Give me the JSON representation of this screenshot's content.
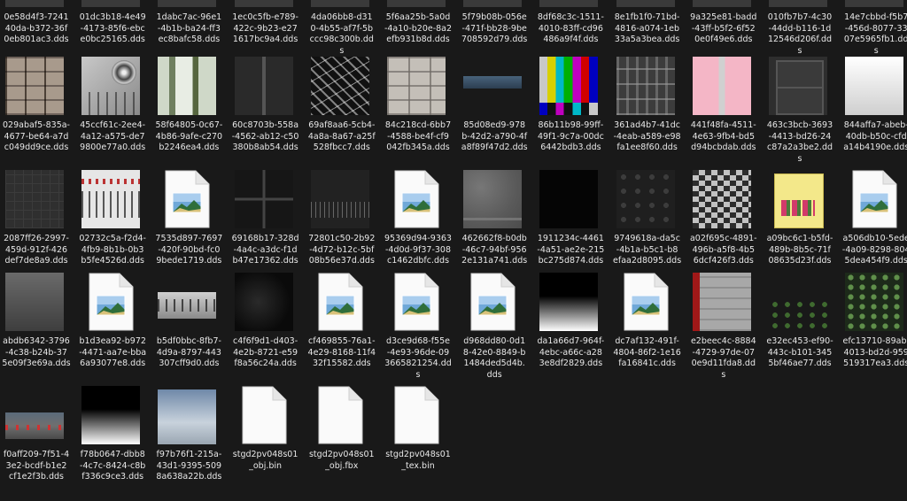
{
  "tiles": [
    {
      "lines": [
        "0e58d4f3-7241",
        "40da-b372-36f",
        "0eb801ac3.dds"
      ],
      "thumb": "dark-strip"
    },
    {
      "lines": [
        "01dc3b18-4e49",
        "-4173-85f6-ebc",
        "e0bc25165.dds"
      ],
      "thumb": "dark-strip"
    },
    {
      "lines": [
        "1dabc7ac-96e1",
        "-4b1b-ba24-ff3",
        "ec8bafc58.dds"
      ],
      "thumb": "dark-strip"
    },
    {
      "lines": [
        "1ec0c5fb-e789-",
        "422c-9b23-e27",
        "1617bc9a4.dds"
      ],
      "thumb": "dark-strip"
    },
    {
      "lines": [
        "4da06bb8-d31",
        "0-4b55-af7f-5b",
        "ccc98c300b.dd",
        "s"
      ],
      "thumb": "dark-strip"
    },
    {
      "lines": [
        "5f6aa25b-5a0d",
        "-4a10-b20e-8a2",
        "efb931b8d.dds"
      ],
      "thumb": "dark-strip"
    },
    {
      "lines": [
        "5f79b08b-056e",
        "-471f-bb28-9be",
        "708592d79.dds"
      ],
      "thumb": "dark-strip"
    },
    {
      "lines": [
        "8df68c3c-1511-",
        "4010-83ff-cd96",
        "486a9f4f.dds"
      ],
      "thumb": "dark-strip"
    },
    {
      "lines": [
        "8e1fb1f0-71bd-",
        "4816-a074-1eb",
        "33a5a3bea.dds"
      ],
      "thumb": "dark-strip"
    },
    {
      "lines": [
        "9a325e81-badd",
        "-43ff-b5f2-6f52",
        "0e0f49e6.dds"
      ],
      "thumb": "dark-strip"
    },
    {
      "lines": [
        "010fb7b7-4c30",
        "-44dd-b116-1d",
        "12546d206f.dd",
        "s"
      ],
      "thumb": "dark-strip"
    },
    {
      "lines": [
        "14e7cbbd-f5b7",
        "-456d-8077-33",
        "07e5965fb1.dd",
        "s"
      ],
      "thumb": "dark-strip"
    },
    {
      "lines": [
        "029abaf5-835a-",
        "4677-be64-a7d",
        "c049dd9ce.dds"
      ],
      "thumb": "bricks"
    },
    {
      "lines": [
        "45ccf61c-2ee4-",
        "4a12-a575-de7",
        "9800e77a0.dds"
      ],
      "thumb": "panel-speaker"
    },
    {
      "lines": [
        "58f64805-0c67-",
        "4b86-9afe-c270",
        "b2246ea4.dds"
      ],
      "thumb": "green-stripes"
    },
    {
      "lines": [
        "60c8703b-558a",
        "-4562-ab12-c50",
        "380b8ab54.dds"
      ],
      "thumb": "dark-road"
    },
    {
      "lines": [
        "69af8aa6-5cb4-",
        "4a8a-8a67-a25f",
        "528fbcc7.dds"
      ],
      "thumb": "bw-atlas"
    },
    {
      "lines": [
        "84c218cd-6bb7",
        "-4588-be4f-cf9",
        "042fb345a.dds"
      ],
      "thumb": "bricks-light"
    },
    {
      "lines": [
        "85d08ed9-978",
        "b-42d2-a790-4f",
        "a8f89f47d2.dds"
      ],
      "thumb": "blue-strip"
    },
    {
      "lines": [
        "86b11b98-99ff-",
        "49f1-9c7a-00dc",
        "6442bdb3.dds"
      ],
      "thumb": "color-bars"
    },
    {
      "lines": [
        "361ad4b7-41dc",
        "-4eab-a589-e98",
        "fa1ee8f60.dds"
      ],
      "thumb": "gray-atlas"
    },
    {
      "lines": [
        "441f48fa-4511-",
        "4e63-9fb4-bd5",
        "d94bcbdab.dds"
      ],
      "thumb": "pink"
    },
    {
      "lines": [
        "463c3bcb-3693",
        "-4413-bd26-24",
        "c87a2a3be2.dd",
        "s"
      ],
      "thumb": "door"
    },
    {
      "lines": [
        "844affa7-abeb-",
        "40db-b50c-cfd",
        "a14b4190e.dds"
      ],
      "thumb": "white-grad"
    },
    {
      "lines": [
        "2087ff26-2997-",
        "459d-912f-426",
        "def7de8a9.dds"
      ],
      "thumb": "dark-grid"
    },
    {
      "lines": [
        "02732c5a-f2d4-",
        "4fb9-8b1b-0b3",
        "b5fe4526d.dds"
      ],
      "thumb": "mixer"
    },
    {
      "lines": [
        "7535d897-7697",
        "-420f-90bd-fc0",
        "9bede1719.dds"
      ],
      "thumb": "file"
    },
    {
      "lines": [
        "69168b17-328d",
        "-4a4c-a3dc-f1d",
        "b47e17362.dds"
      ],
      "thumb": "dark-cross"
    },
    {
      "lines": [
        "72801c50-2b92",
        "-4d72-b12c-5bf",
        "08b56e37d.dds"
      ],
      "thumb": "dark-rows"
    },
    {
      "lines": [
        "95369d94-9363",
        "-4d0d-9f37-308",
        "c1462dbfc.dds"
      ],
      "thumb": "file"
    },
    {
      "lines": [
        "462662f8-b0db",
        "-46c7-94bf-956",
        "2e131a741.dds"
      ],
      "thumb": "concrete"
    },
    {
      "lines": [
        "1911234c-4461",
        "-4a51-ae2e-215",
        "bc275d874.dds"
      ],
      "thumb": "black"
    },
    {
      "lines": [
        "9749618a-da5c",
        "-4b1a-b5c1-b8",
        "efaa2d8095.dds"
      ],
      "thumb": "hex"
    },
    {
      "lines": [
        "a02f695c-4891-",
        "496b-a5f8-4b5",
        "6dcf426f3.dds"
      ],
      "thumb": "mosaic"
    },
    {
      "lines": [
        "a09bc6c1-b5fd-",
        "489b-8b5c-71f",
        "08635d23f.dds"
      ],
      "thumb": "poster"
    },
    {
      "lines": [
        "a506db10-5ede",
        "-4a09-8298-804",
        "5dea454f9.dds"
      ],
      "thumb": "file"
    },
    {
      "lines": [
        "abdb6342-3796",
        "-4c38-b24b-37",
        "5e09f3e69a.dds"
      ],
      "thumb": "gray-grad"
    },
    {
      "lines": [
        "b1d3ea92-b972",
        "-4471-aa7e-bba",
        "6a93077e8.dds"
      ],
      "thumb": "file"
    },
    {
      "lines": [
        "b5df0bbc-8fb7-",
        "4d9a-8797-443",
        "307cff9d0.dds"
      ],
      "thumb": "machine"
    },
    {
      "lines": [
        "c4f6f9d1-d403-",
        "4e2b-8721-e59",
        "f8a56c24a.dds"
      ],
      "thumb": "dark-noise"
    },
    {
      "lines": [
        "cf469855-76a1-",
        "4e29-8168-11f4",
        "32f15582.dds"
      ],
      "thumb": "file"
    },
    {
      "lines": [
        "d3ce9d68-f55e",
        "-4e93-96de-09",
        "3665821254.dd",
        "s"
      ],
      "thumb": "file"
    },
    {
      "lines": [
        "d968dd80-0d1",
        "8-42e0-8849-b",
        "1484ded5d4b.",
        "dds"
      ],
      "thumb": "file"
    },
    {
      "lines": [
        "da1a66d7-964f-",
        "4ebc-a66c-a28",
        "3e8df2829.dds"
      ],
      "thumb": "black-white-grad"
    },
    {
      "lines": [
        "dc7af132-491f-",
        "4804-86f2-1e16",
        "fa16841c.dds"
      ],
      "thumb": "file"
    },
    {
      "lines": [
        "e2beec4c-8884",
        "-4729-97de-07",
        "0e9d11fda8.dd",
        "s"
      ],
      "thumb": "red-gray"
    },
    {
      "lines": [
        "e32ec453-ef90-",
        "443c-b101-345",
        "5bf46ae77.dds"
      ],
      "thumb": "plants-dark"
    },
    {
      "lines": [
        "efc13710-89ab-",
        "4013-bd2d-959",
        "519317ea3.dds"
      ],
      "thumb": "plants-green"
    },
    {
      "lines": [
        "f0aff209-7f51-4",
        "3e2-bcdf-b1e2",
        "cf1e2f3b.dds"
      ],
      "thumb": "street"
    },
    {
      "lines": [
        "f78b0647-dbb8",
        "-4c7c-8424-c8b",
        "f336c9ce3.dds"
      ],
      "thumb": "black-white-grad"
    },
    {
      "lines": [
        "f97b76f1-215a-",
        "43d1-9395-509",
        "8a638a22b.dds"
      ],
      "thumb": "sky"
    },
    {
      "lines": [
        "stgd2pv048s01",
        "_obj.bin"
      ],
      "thumb": "blank-file"
    },
    {
      "lines": [
        "stgd2pv048s01",
        "_obj.fbx"
      ],
      "thumb": "blank-file"
    },
    {
      "lines": [
        "stgd2pv048s01",
        "_tex.bin"
      ],
      "thumb": "blank-file"
    }
  ]
}
